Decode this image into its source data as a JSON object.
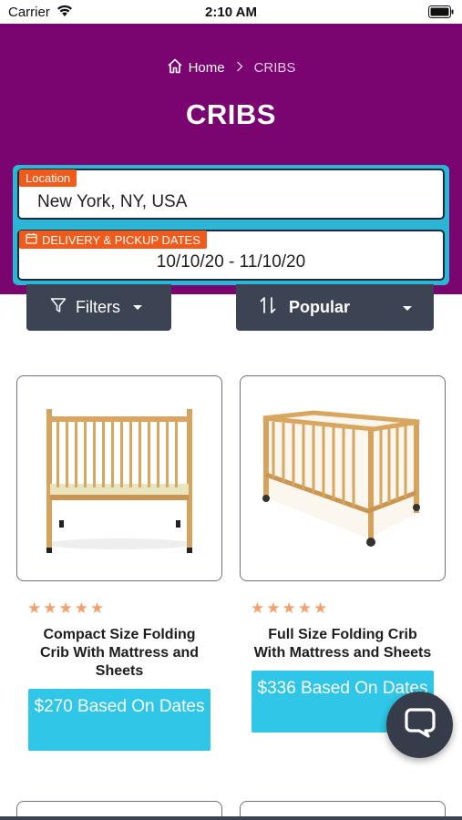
{
  "status_bar": {
    "carrier": "Carrier",
    "time": "2:10 AM"
  },
  "breadcrumb": {
    "home": "Home",
    "current": "CRIBS"
  },
  "page_title": "CRIBS",
  "search": {
    "location_label": "Location",
    "location_value": "New York, NY, USA",
    "dates_label": "DELIVERY & PICKUP DATES",
    "dates_value": "10/10/20 - 11/10/20"
  },
  "toolbar": {
    "filters_label": "Filters",
    "sort_label": "Popular"
  },
  "products": [
    {
      "name": "Compact Size Folding Crib With Mattress and Sheets",
      "rating": 5,
      "price_label": "$270 Based On Dates"
    },
    {
      "name": "Full Size Folding Crib With Mattress and Sheets",
      "rating": 5,
      "price_label": "$336 Based On Dates"
    }
  ],
  "colors": {
    "header_bg": "#7a0570",
    "accent": "#2bb6d6",
    "tag": "#f05a1a",
    "button_dark": "#3c4352",
    "price": "#2fc6e8",
    "star": "#f5a06b"
  }
}
